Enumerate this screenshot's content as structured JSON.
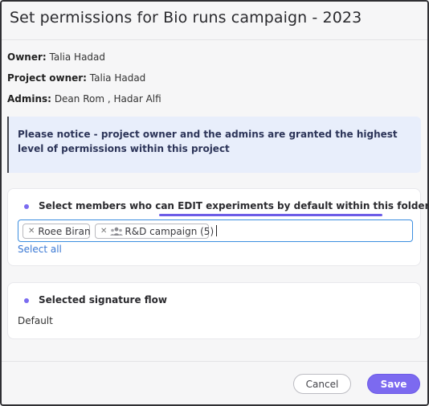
{
  "dialog": {
    "title": "Set permissions for Bio runs campaign - 2023"
  },
  "meta": {
    "owner_label": "Owner:",
    "owner_value": "Talia Hadad",
    "project_owner_label": "Project owner:",
    "project_owner_value": "Talia Hadad",
    "admins_label": "Admins:",
    "admins_value": "Dean Rom , Hadar Alfi"
  },
  "notice": {
    "text": "Please notice - project owner and the admins are granted the highest level of permissions within this project"
  },
  "edit_section": {
    "title_prefix": "Select members who can ",
    "title_highlight": "EDIT experiments by default within this folder:",
    "chips": [
      {
        "label": "Roee Biran",
        "icon": "none"
      },
      {
        "label": "R&D campaign (5)",
        "icon": "group-icon"
      }
    ],
    "select_all_label": "Select all"
  },
  "signature_section": {
    "title": "Selected signature flow",
    "value": "Default"
  },
  "footer": {
    "cancel_label": "Cancel",
    "save_label": "Save"
  },
  "colors": {
    "accent": "#7c6af0",
    "notice_bg": "#e8eefb",
    "link": "#3a78d4",
    "input_focus": "#3d8fe0"
  }
}
